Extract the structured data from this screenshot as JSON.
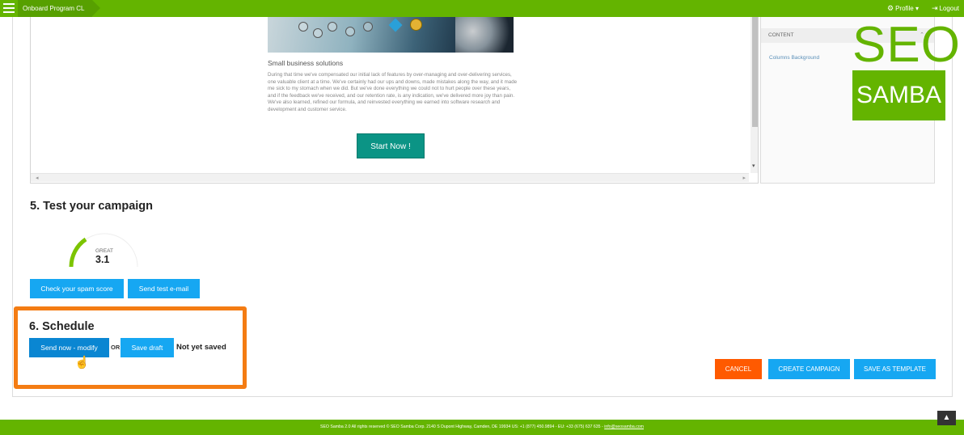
{
  "topbar": {
    "breadcrumb": "Onboard Program CL",
    "profile_label": "Profile",
    "profile_icon": "gear-icon",
    "logout_label": "Logout",
    "logout_icon": "logout-icon"
  },
  "editor": {
    "article_title": "Small business solutions",
    "article_body": "During that time we've compensated our initial lack of features by over-managing and over-delivering services, one valuable client at a time. We've certainly had our ups and downs, made mistakes along the way, and it made me sick to my stomach when we did. But we've done everything we could not to hurt people over these years, and if the feedback we've received, and our retention rate, is any indication, we've delivered more joy than pain. We've also learned, refined our formula, and reinvested everything we earned into software research and development and customer service.",
    "start_button": "Start Now !"
  },
  "side_panel": {
    "header": "CONTENT",
    "item": "Columns Background"
  },
  "logo": {
    "line1": "SEO",
    "line2": "SAMBA"
  },
  "test_section": {
    "title": "5. Test your campaign",
    "gauge_label": "GREAT",
    "gauge_score": "3.1",
    "spam_button": "Check your spam score",
    "test_button": "Send test e-mail"
  },
  "schedule_section": {
    "title": "6. Schedule",
    "send_button": "Send now - modify",
    "or_label": "OR",
    "draft_button": "Save draft",
    "status": "Not yet saved"
  },
  "actions": {
    "cancel": "CANCEL",
    "create": "CREATE CAMPAIGN",
    "template": "SAVE AS TEMPLATE"
  },
  "footer": {
    "text": "SEO Samba 2.0  All rights reserved © SEO Samba Corp. 2140 S Dupont Highway, Camden, DE 19934 US: +1 (877) 450.9894 - EU: +33 (675) 637 635 - ",
    "email": "info@seosamba.com"
  },
  "colors": {
    "brand_green": "#64b400",
    "button_blue": "#16a7f2",
    "cancel_orange": "#ff5a00",
    "highlight_orange": "#f47c13",
    "start_teal": "#0b9485"
  }
}
